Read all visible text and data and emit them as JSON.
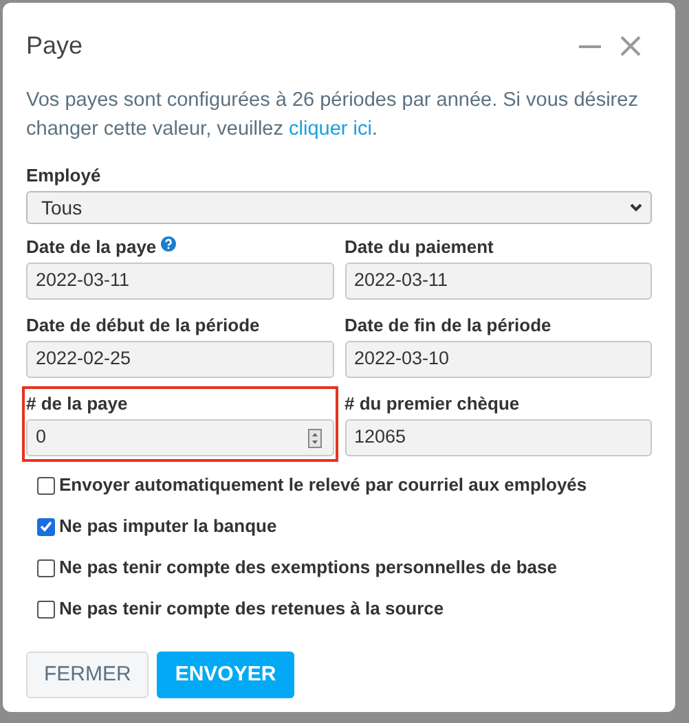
{
  "dialog": {
    "title": "Paye",
    "description": {
      "text": "Vos payes sont configurées à 26 périodes par année. Si vous désirez changer cette valeur, veuillez ",
      "link": "cliquer ici",
      "after": "."
    }
  },
  "employee": {
    "label": "Employé",
    "value": "Tous"
  },
  "fields": [
    {
      "label": "Date de la paye",
      "value": "2022-03-11",
      "help": true,
      "highlighted": false,
      "spinner": false
    },
    {
      "label": "Date du paiement",
      "value": "2022-03-11",
      "help": false,
      "highlighted": false,
      "spinner": false
    },
    {
      "label": "Date de début de la période",
      "value": "2022-02-25",
      "help": false,
      "highlighted": false,
      "spinner": false
    },
    {
      "label": "Date de fin de la période",
      "value": "2022-03-10",
      "help": false,
      "highlighted": false,
      "spinner": false
    },
    {
      "label": "# de la paye",
      "value": "0",
      "help": false,
      "highlighted": true,
      "spinner": true
    },
    {
      "label": "# du premier chèque",
      "value": "12065",
      "help": false,
      "highlighted": false,
      "spinner": false
    }
  ],
  "options": [
    {
      "label": "Envoyer automatiquement le relevé par courriel aux employés",
      "checked": false
    },
    {
      "label": "Ne pas imputer la banque",
      "checked": true
    },
    {
      "label": "Ne pas tenir compte des exemptions personnelles de base",
      "checked": false
    },
    {
      "label": "Ne pas tenir compte des retenues à la source",
      "checked": false
    }
  ],
  "buttons": [
    {
      "label": "FERMER",
      "kind": "secondary"
    },
    {
      "label": "ENVOYER",
      "kind": "primary"
    }
  ]
}
